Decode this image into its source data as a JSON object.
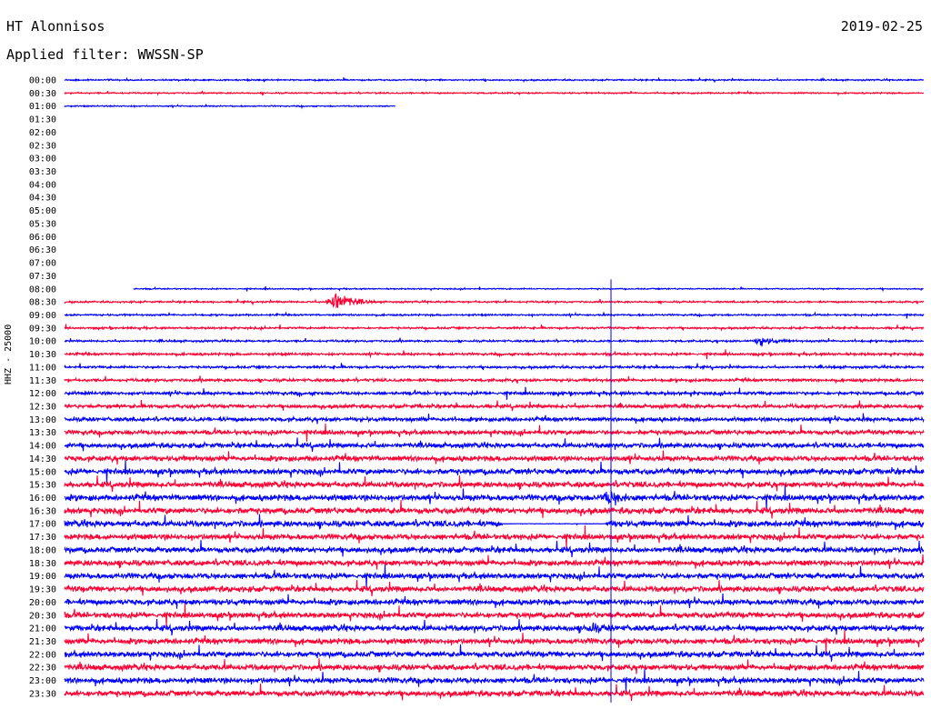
{
  "header": {
    "station": "HT Alonnisos",
    "date": "2019-02-25",
    "filter_label": "Applied filter:",
    "filter_value": "WWSSN-SP"
  },
  "chart_data": {
    "type": "line",
    "title": "HT Alonnisos",
    "ylabel": "HHZ - 25000",
    "row_labels": [
      "00:00",
      "00:30",
      "01:00",
      "01:30",
      "02:00",
      "02:30",
      "03:00",
      "03:30",
      "04:00",
      "04:30",
      "05:00",
      "05:30",
      "06:00",
      "06:30",
      "07:00",
      "07:30",
      "08:00",
      "08:30",
      "09:00",
      "09:30",
      "10:00",
      "10:30",
      "11:00",
      "11:30",
      "12:00",
      "12:30",
      "13:00",
      "13:30",
      "14:00",
      "14:30",
      "15:00",
      "15:30",
      "16:00",
      "16:30",
      "17:00",
      "17:30",
      "18:00",
      "18:30",
      "19:00",
      "19:30",
      "20:00",
      "20:30",
      "21:00",
      "21:30",
      "22:00",
      "22:30",
      "23:00",
      "23:30"
    ],
    "x_range_minutes": [
      0,
      30
    ],
    "colors": {
      "even": "#0000ff",
      "odd": "#ff0033"
    },
    "segments": [
      {
        "row": 0,
        "start": 0.0,
        "end": 1.0,
        "noise": 0.18
      },
      {
        "row": 1,
        "start": 0.0,
        "end": 1.0,
        "noise": 0.18
      },
      {
        "row": 2,
        "start": 0.0,
        "end": 0.385,
        "noise": 0.16
      },
      {
        "row": 16,
        "start": 0.08,
        "end": 1.0,
        "noise": 0.15
      },
      {
        "row": 17,
        "start": 0.0,
        "end": 1.0,
        "noise": 0.22
      },
      {
        "row": 18,
        "start": 0.0,
        "end": 1.0,
        "noise": 0.22
      },
      {
        "row": 19,
        "start": 0.0,
        "end": 1.0,
        "noise": 0.25
      },
      {
        "row": 20,
        "start": 0.0,
        "end": 1.0,
        "noise": 0.25
      },
      {
        "row": 21,
        "start": 0.0,
        "end": 1.0,
        "noise": 0.3
      },
      {
        "row": 22,
        "start": 0.0,
        "end": 1.0,
        "noise": 0.3
      },
      {
        "row": 23,
        "start": 0.0,
        "end": 1.0,
        "noise": 0.35
      },
      {
        "row": 24,
        "start": 0.0,
        "end": 1.0,
        "noise": 0.4
      },
      {
        "row": 25,
        "start": 0.0,
        "end": 1.0,
        "noise": 0.45
      },
      {
        "row": 26,
        "start": 0.0,
        "end": 1.0,
        "noise": 0.5
      },
      {
        "row": 27,
        "start": 0.0,
        "end": 1.0,
        "noise": 0.55
      },
      {
        "row": 28,
        "start": 0.0,
        "end": 1.0,
        "noise": 0.6
      },
      {
        "row": 29,
        "start": 0.0,
        "end": 1.0,
        "noise": 0.65
      },
      {
        "row": 30,
        "start": 0.0,
        "end": 1.0,
        "noise": 0.7
      },
      {
        "row": 31,
        "start": 0.0,
        "end": 1.0,
        "noise": 0.7
      },
      {
        "row": 32,
        "start": 0.0,
        "end": 1.0,
        "noise": 0.75
      },
      {
        "row": 33,
        "start": 0.0,
        "end": 1.0,
        "noise": 0.75
      },
      {
        "row": 34,
        "start": 0.0,
        "end": 0.51,
        "noise": 0.75
      },
      {
        "row": 34,
        "start": 0.51,
        "end": 0.63,
        "noise": 0.08
      },
      {
        "row": 34,
        "start": 0.63,
        "end": 1.0,
        "noise": 0.75
      },
      {
        "row": 35,
        "start": 0.0,
        "end": 1.0,
        "noise": 0.7
      },
      {
        "row": 36,
        "start": 0.0,
        "end": 1.0,
        "noise": 0.7
      },
      {
        "row": 37,
        "start": 0.0,
        "end": 1.0,
        "noise": 0.7
      },
      {
        "row": 38,
        "start": 0.0,
        "end": 1.0,
        "noise": 0.7
      },
      {
        "row": 39,
        "start": 0.0,
        "end": 1.0,
        "noise": 0.7
      },
      {
        "row": 40,
        "start": 0.0,
        "end": 1.0,
        "noise": 0.7
      },
      {
        "row": 41,
        "start": 0.0,
        "end": 1.0,
        "noise": 0.7
      },
      {
        "row": 42,
        "start": 0.0,
        "end": 1.0,
        "noise": 0.7
      },
      {
        "row": 43,
        "start": 0.0,
        "end": 1.0,
        "noise": 0.7
      },
      {
        "row": 44,
        "start": 0.0,
        "end": 1.0,
        "noise": 0.7
      },
      {
        "row": 45,
        "start": 0.0,
        "end": 1.0,
        "noise": 0.7
      },
      {
        "row": 46,
        "start": 0.0,
        "end": 1.0,
        "noise": 0.7
      },
      {
        "row": 47,
        "start": 0.0,
        "end": 1.0,
        "noise": 0.7
      }
    ],
    "events": [
      {
        "row": 17,
        "at": 0.315,
        "amplitude": 3.2,
        "width": 0.012
      },
      {
        "row": 20,
        "at": 0.811,
        "amplitude": 1.2,
        "width": 0.01
      },
      {
        "row": 32,
        "at": 0.634,
        "amplitude": 1.6,
        "width": 0.01
      },
      {
        "row": 42,
        "at": 0.613,
        "amplitude": 0.8,
        "width": 0.01
      }
    ],
    "spikes": [
      {
        "at": 0.636,
        "top_row": 15,
        "bottom_row": 47
      }
    ]
  }
}
